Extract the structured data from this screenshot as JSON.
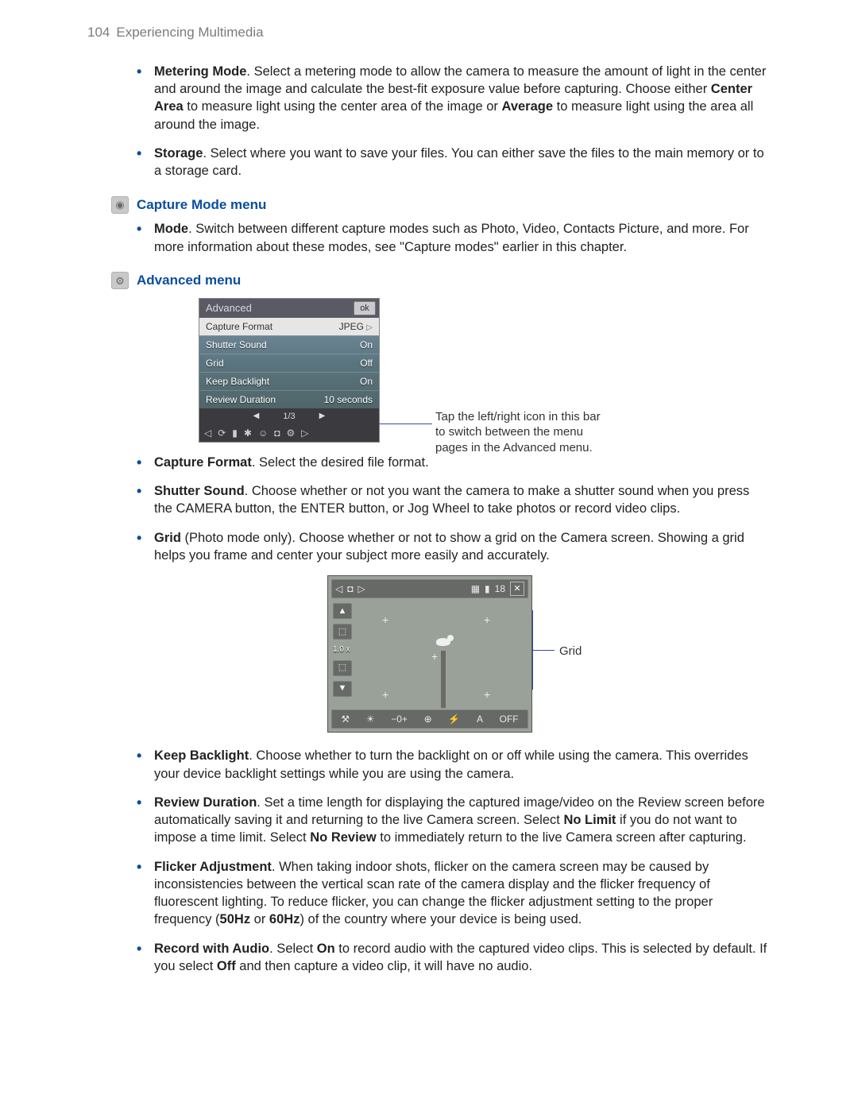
{
  "header": {
    "page_number": "104",
    "chapter": "Experiencing Multimedia"
  },
  "top_bullets": [
    {
      "title": "Metering Mode",
      "text_a": ". Select a metering mode to allow the camera to measure the amount of light in the center and around the image and calculate the best-fit exposure value before capturing. Choose either ",
      "bold_b": "Center Area",
      "text_b": " to measure light using the center area of the image or ",
      "bold_c": "Average",
      "text_c": " to measure light using the area all around the image."
    },
    {
      "title": "Storage",
      "text_a": ". Select where you want to save your files. You can either save the files to the main memory or to a storage card."
    }
  ],
  "capture_mode": {
    "heading": "Capture Mode menu",
    "bullet_title": "Mode",
    "bullet_text": ". Switch between different capture modes such as Photo, Video, Contacts Picture, and more. For more information about these modes, see \"Capture modes\" earlier in this chapter."
  },
  "advanced": {
    "heading": "Advanced menu",
    "menu": {
      "title": "Advanced",
      "ok": "ok",
      "selected": {
        "label": "Capture Format",
        "value": "JPEG"
      },
      "rows": [
        {
          "label": "Shutter Sound",
          "value": "On"
        },
        {
          "label": "Grid",
          "value": "Off"
        },
        {
          "label": "Keep Backlight",
          "value": "On"
        },
        {
          "label": "Review Duration",
          "value": "10 seconds"
        }
      ],
      "page": "1/3"
    },
    "callout": "Tap the left/right icon in this bar to switch between the menu pages in the Advanced menu."
  },
  "mid_bullets": [
    {
      "title": "Capture Format",
      "text_a": ". Select the desired file format."
    },
    {
      "title": "Shutter Sound",
      "text_a": ". Choose whether or not you want the camera to make a shutter sound when you press the CAMERA button, the ENTER button, or Jog Wheel to take photos or record video clips."
    },
    {
      "title": "Grid",
      "text_a": " (Photo mode only). Choose whether or not to show a grid on the Camera screen. Showing a grid helps you frame and center your subject more easily and accurately."
    }
  ],
  "grid_shot": {
    "zoom": "1.0 x",
    "count": "18",
    "callout": "Grid"
  },
  "bottom_bullets": [
    {
      "title": "Keep Backlight",
      "text_a": ". Choose whether to turn the backlight on or off while using the camera. This overrides your device backlight settings while you are using the camera."
    },
    {
      "title": "Review Duration",
      "text_a": ". Set a time length for displaying the captured image/video on the Review screen before automatically saving it and returning to the live Camera screen. Select ",
      "bold_b": "No Limit",
      "text_b": " if you do not want to impose a time limit. Select ",
      "bold_c": "No Review",
      "text_c": "  to immediately return to the live Camera screen after capturing."
    },
    {
      "title": "Flicker Adjustment",
      "text_a": ". When taking indoor shots, flicker on the camera screen may be caused by inconsistencies between the vertical scan rate of the camera display and the flicker frequency of fluorescent lighting. To reduce flicker, you can change the flicker adjustment setting to the proper frequency (",
      "bold_b": "50Hz",
      "text_b": " or ",
      "bold_c": "60Hz",
      "text_c": ") of the country where your device is being used."
    },
    {
      "title": "Record with Audio",
      "text_a": ". Select ",
      "bold_b": "On",
      "text_b": " to record audio with the captured video clips. This is selected by default. If you select ",
      "bold_c": "Off",
      "text_c": " and then capture a video clip, it will have no audio."
    }
  ]
}
